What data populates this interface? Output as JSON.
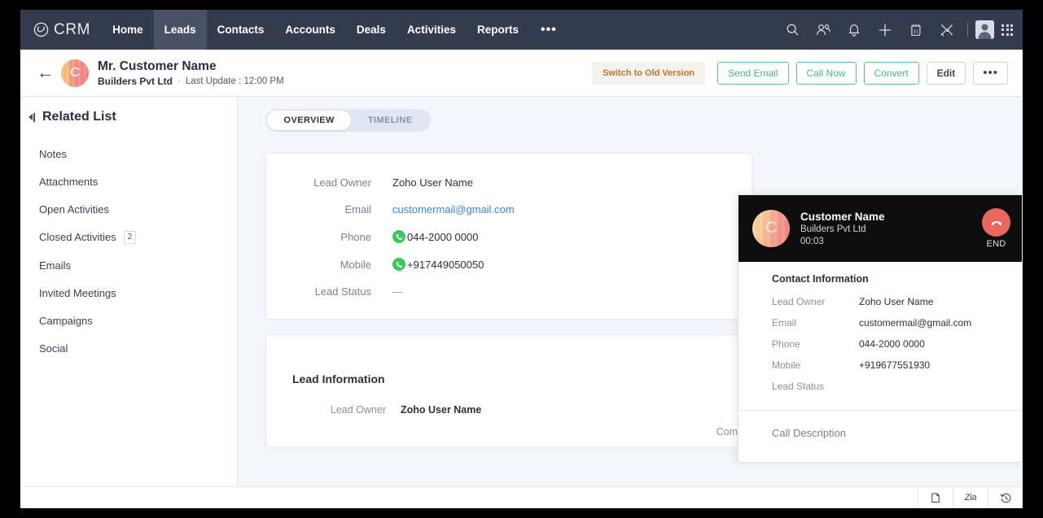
{
  "app": {
    "logo_text": "CRM",
    "logo_icon": "zoho-crm-logo-icon"
  },
  "topnav": {
    "items": [
      {
        "label": "Home",
        "active": false
      },
      {
        "label": "Leads",
        "active": true
      },
      {
        "label": "Contacts",
        "active": false
      },
      {
        "label": "Accounts",
        "active": false
      },
      {
        "label": "Deals",
        "active": false
      },
      {
        "label": "Activities",
        "active": false
      },
      {
        "label": "Reports",
        "active": false
      }
    ],
    "more_label": "•••",
    "icons": [
      "search-icon",
      "users-icon",
      "bell-icon",
      "plus-icon",
      "calendar-icon",
      "tools-icon"
    ],
    "calendar_day": "31",
    "accent_bg": "#353b4e",
    "active_bg": "#4a5065"
  },
  "record_header": {
    "back_icon": "back-arrow-icon",
    "avatar_initial": "C",
    "name": "Mr. Customer Name",
    "company": "Builders Pvt Ltd",
    "separator": "·",
    "last_update": "Last Update : 12:00 PM",
    "actions": {
      "switch_old": "Switch to Old Version",
      "send_email": "Send Email",
      "call_now": "Call Now",
      "convert": "Convert",
      "edit": "Edit",
      "more": "•••"
    },
    "green": "#5dc08f",
    "old_version_text_color": "#b9772f"
  },
  "sidebar": {
    "title": "Related List",
    "collapse_icon": "collapse-panel-icon",
    "items": [
      {
        "label": "Notes",
        "badge": ""
      },
      {
        "label": "Attachments",
        "badge": ""
      },
      {
        "label": "Open Activities",
        "badge": ""
      },
      {
        "label": "Closed Activities",
        "badge": "2"
      },
      {
        "label": "Emails",
        "badge": ""
      },
      {
        "label": "Invited Meetings",
        "badge": ""
      },
      {
        "label": "Campaigns",
        "badge": ""
      },
      {
        "label": "Social",
        "badge": ""
      }
    ]
  },
  "main": {
    "tabs": [
      {
        "label": "OVERVIEW",
        "active": true
      },
      {
        "label": "TIMELINE",
        "active": false
      }
    ],
    "summary_card": {
      "rows": [
        {
          "label": "Lead Owner",
          "value": "Zoho User Name",
          "style": "text"
        },
        {
          "label": "Email",
          "value": "customermail@gmail.com",
          "style": "link"
        },
        {
          "label": "Phone",
          "value": "044-2000 0000",
          "style": "phone"
        },
        {
          "label": "Mobile",
          "value": "+917449050050",
          "style": "phone"
        },
        {
          "label": "Lead Status",
          "value": "—",
          "style": "dash"
        }
      ],
      "phone_icon": "phone-call-icon",
      "phone_icon_color": "#3cc85a"
    },
    "lead_information": {
      "title": "Lead Information",
      "rows": [
        {
          "label": "Lead Owner",
          "value": "Zoho User Name"
        }
      ],
      "right_column_label": "Comp"
    }
  },
  "call_popup": {
    "avatar_initial": "C",
    "name": "Customer Name",
    "company": "Builders Pvt Ltd",
    "timer": "00:03",
    "end_label": "END",
    "end_icon": "hang-up-icon",
    "end_color": "#e8685f",
    "header_bg": "#0d0d0d",
    "contact_information": {
      "title": "Contact Information",
      "rows": [
        {
          "label": "Lead Owner",
          "value": "Zoho User Name"
        },
        {
          "label": "Email",
          "value": "customermail@gmail.com"
        },
        {
          "label": "Phone",
          "value": "044-2000 0000"
        },
        {
          "label": "Mobile",
          "value": "+919677551930"
        },
        {
          "label": "Lead Status",
          "value": ""
        }
      ]
    },
    "description_placeholder": "Call Description"
  },
  "bottom_bar": {
    "buttons": [
      {
        "name": "chat-icon",
        "label": ""
      },
      {
        "name": "zia-icon",
        "label": "Zia"
      },
      {
        "name": "recent-history-icon",
        "label": ""
      }
    ]
  }
}
